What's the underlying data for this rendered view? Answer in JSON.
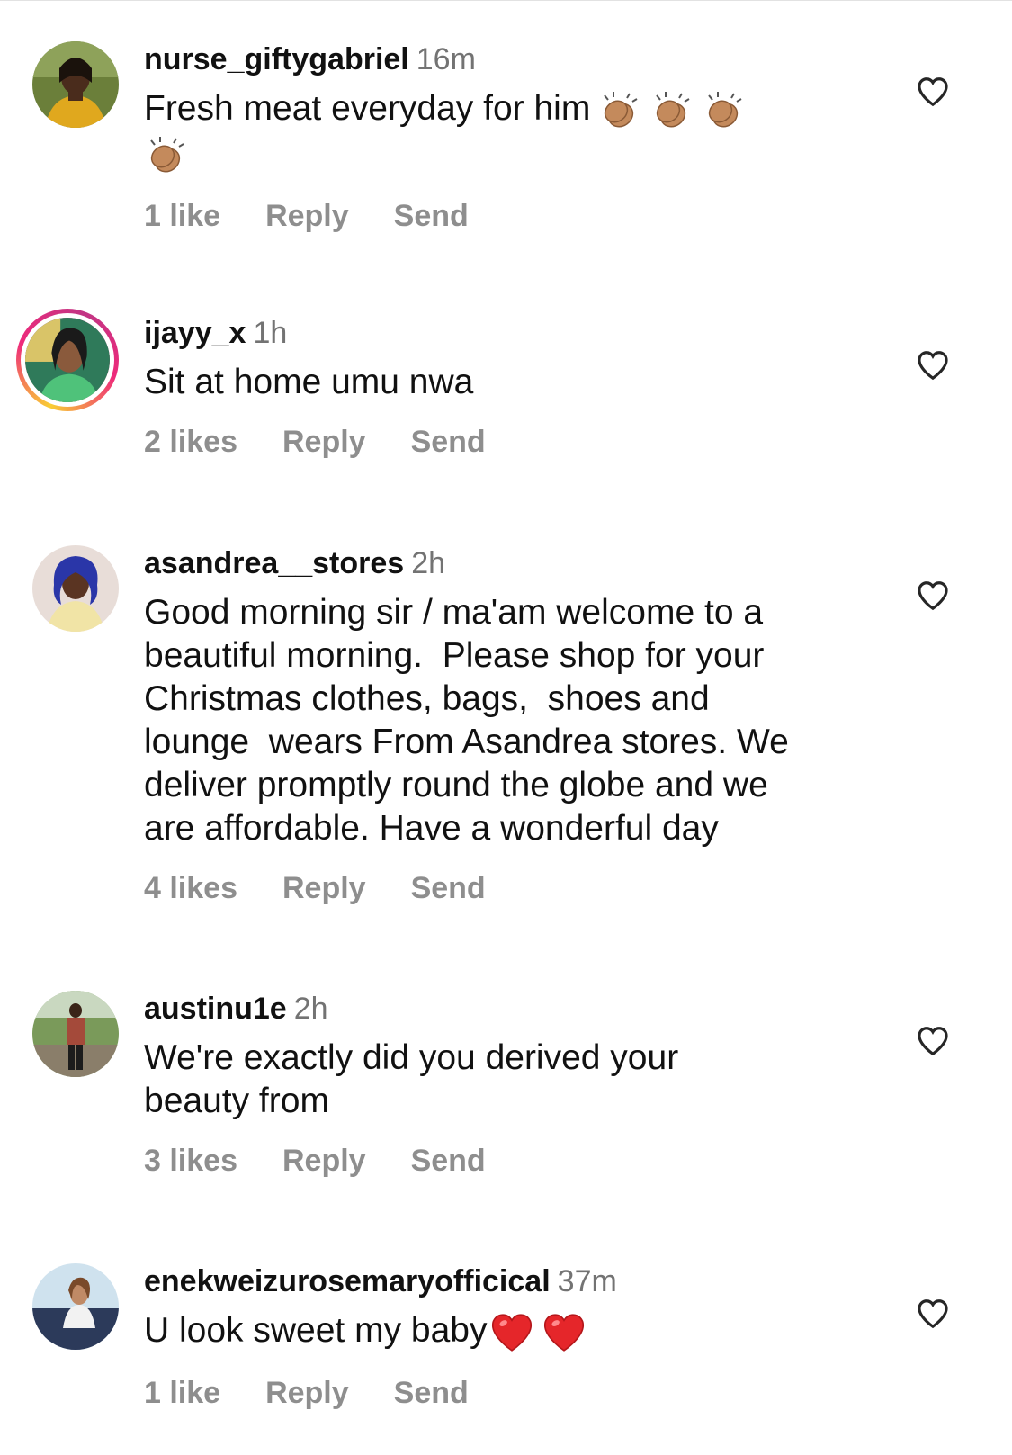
{
  "comments": [
    {
      "username": "nurse_giftygabriel",
      "time": "16m",
      "text": "Fresh meat everyday for him",
      "likes": "1 like",
      "reply": "Reply",
      "send": "Send",
      "emoji": "clapping-hands",
      "emoji_count": 4,
      "story_ring": false
    },
    {
      "username": "ijayy_x",
      "time": "1h",
      "text": "Sit at home umu nwa",
      "likes": "2 likes",
      "reply": "Reply",
      "send": "Send",
      "story_ring": true
    },
    {
      "username": "asandrea__stores",
      "time": "2h",
      "text": "Good morning sir / ma'am welcome to a\nbeautiful morning.  Please shop for your\nChristmas clothes, bags,  shoes and\nlounge  wears From Asandrea stores. We\ndeliver promptly round the globe and we\nare affordable. Have a wonderful day",
      "likes": "4 likes",
      "reply": "Reply",
      "send": "Send",
      "story_ring": false
    },
    {
      "username": "austinu1e",
      "time": "2h",
      "text": "We're exactly did you derived your\nbeauty from",
      "likes": "3 likes",
      "reply": "Reply",
      "send": "Send",
      "story_ring": false
    },
    {
      "username": "enekweizurosemaryofficical",
      "time": "37m",
      "text": "U look sweet my baby",
      "likes": "1 like",
      "reply": "Reply",
      "send": "Send",
      "emoji": "red-heart",
      "emoji_count": 2,
      "story_ring": false
    }
  ],
  "colors": {
    "text": "#111111",
    "muted": "#737373",
    "action": "#8e8e8e",
    "heart_outline": "#262626"
  }
}
